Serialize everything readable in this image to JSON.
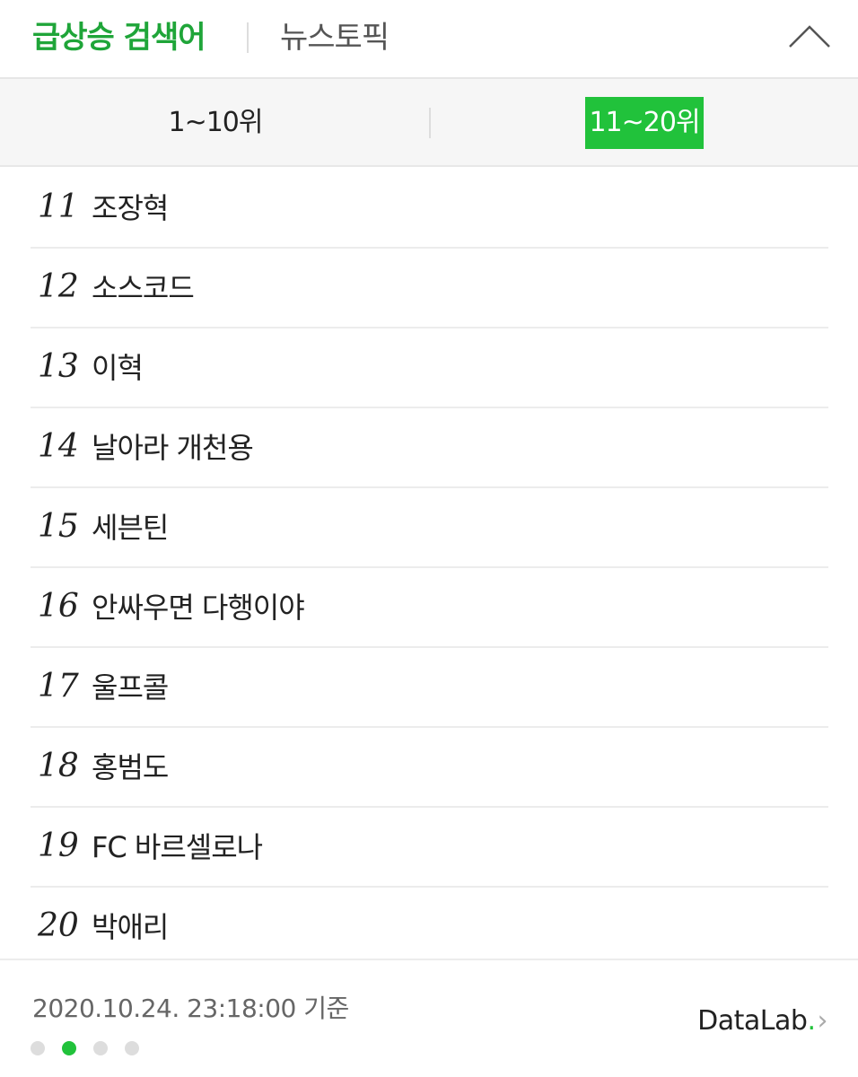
{
  "header": {
    "tab_trending": "급상승 검색어",
    "tab_news": "뉴스토픽",
    "accent_color": "#1fa539",
    "collapse_icon": "chevron-up-icon"
  },
  "range_tabs": {
    "first": "1~10위",
    "second": "11~20위",
    "selected": "11~20위",
    "selected_bg": "#21c23b"
  },
  "ranks": [
    {
      "num": "11",
      "keyword": "조장혁"
    },
    {
      "num": "12",
      "keyword": "소스코드"
    },
    {
      "num": "13",
      "keyword": "이혁"
    },
    {
      "num": "14",
      "keyword": "날아라 개천용"
    },
    {
      "num": "15",
      "keyword": "세븐틴"
    },
    {
      "num": "16",
      "keyword": "안싸우면 다행이야"
    },
    {
      "num": "17",
      "keyword": "울프콜"
    },
    {
      "num": "18",
      "keyword": "홍범도"
    },
    {
      "num": "19",
      "keyword": "FC 바르셀로나"
    },
    {
      "num": "20",
      "keyword": "박애리"
    }
  ],
  "footer": {
    "timestamp": "2020.10.24. 23:18:00 기준",
    "datalab_text": "DataLab",
    "datalab_dot": ".",
    "datalab_arrow": "›",
    "page_count": 4,
    "active_page": 2
  }
}
